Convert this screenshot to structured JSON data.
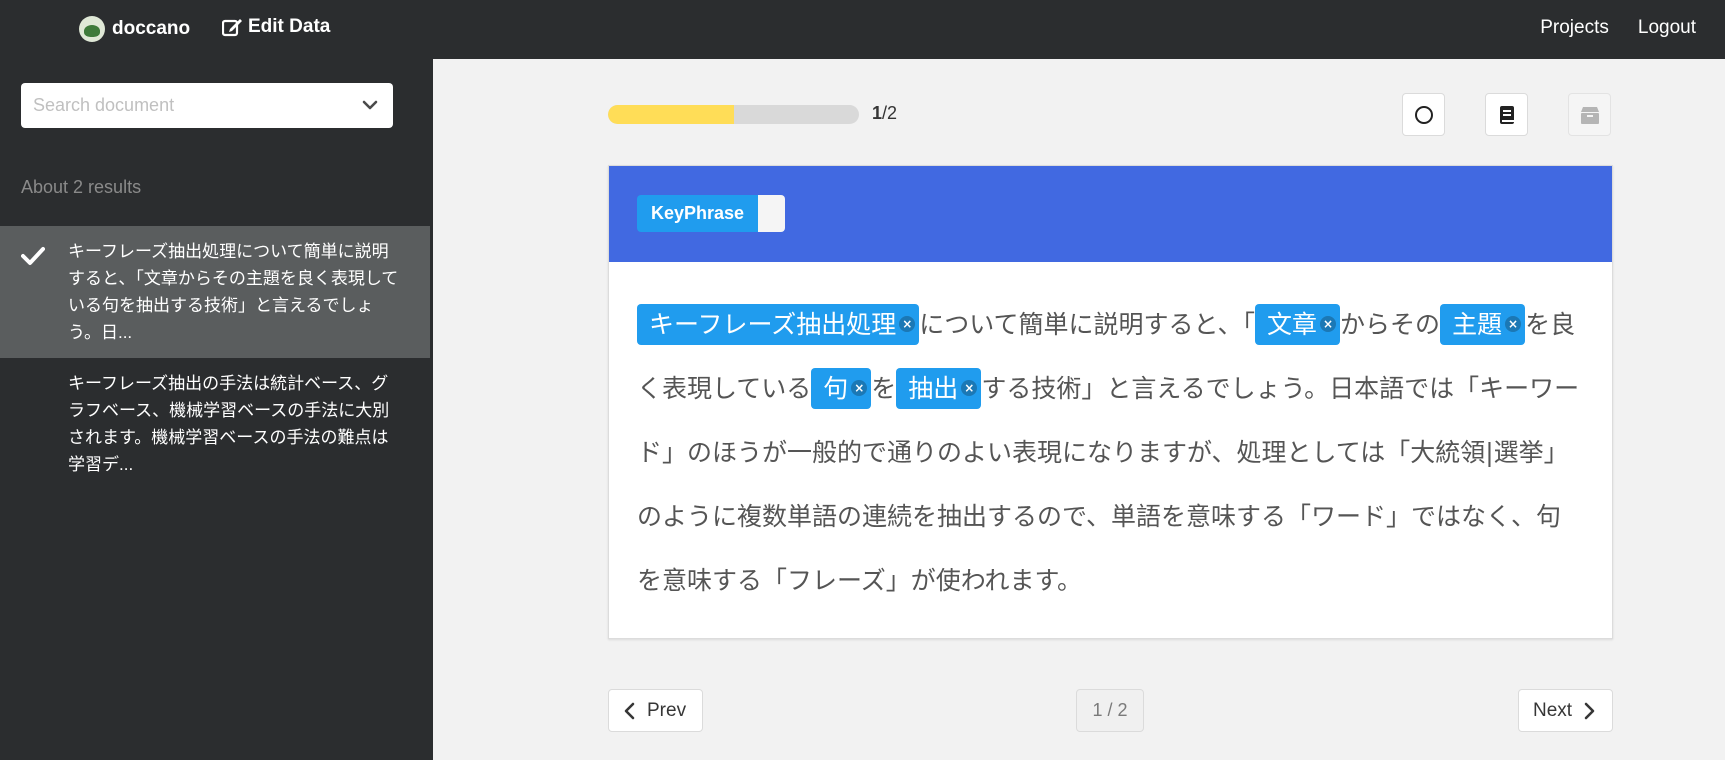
{
  "navbar": {
    "brand": "doccano",
    "edit_data": "Edit Data",
    "projects": "Projects",
    "logout": "Logout"
  },
  "sidebar": {
    "search_placeholder": "Search document",
    "results_count": "About 2 results",
    "documents": [
      {
        "text": "キーフレーズ抽出処理について簡単に説明すると、「文章からその主題を良く表現している句を抽出する技術」と言えるでしょう。日...",
        "active": true
      },
      {
        "text": "キーフレーズ抽出の手法は統計ベース、グラフベース、機械学習ベースの手法に大別されます。機械学習ベースの手法の難点は学習デ...",
        "active": false
      }
    ]
  },
  "progress": {
    "fraction": 0.5,
    "current": "1",
    "total": "/2"
  },
  "labels": [
    {
      "name": "KeyPhrase",
      "shortcut": ""
    }
  ],
  "document": {
    "segments": [
      {
        "t": "キーフレーズ抽出処理",
        "e": true
      },
      {
        "t": "について簡単に説明すると、「"
      },
      {
        "t": "文章",
        "e": true
      },
      {
        "t": "からその"
      },
      {
        "t": "主題",
        "e": true
      },
      {
        "t": "を良く表現している"
      },
      {
        "t": "句",
        "e": true
      },
      {
        "t": "を"
      },
      {
        "t": "抽出",
        "e": true
      },
      {
        "t": "する技術」と言えるでしょう。日本語では「キーワード」のほうが一般的で通りのよい表現になりますが、処理としては「大統領|選挙」のように複数単語の連続を抽出するので、単語を意味する「ワード」ではなく、句を意味する「フレーズ」が使われます。"
      }
    ],
    "remove_glyph": "×"
  },
  "pagination": {
    "prev": "Prev",
    "next": "Next",
    "indicator": "1 / 2"
  },
  "colors": {
    "navbar": "#2b2d2f",
    "header": "#4169e1",
    "entity": "#209cee",
    "progress": "#ffdd57"
  }
}
